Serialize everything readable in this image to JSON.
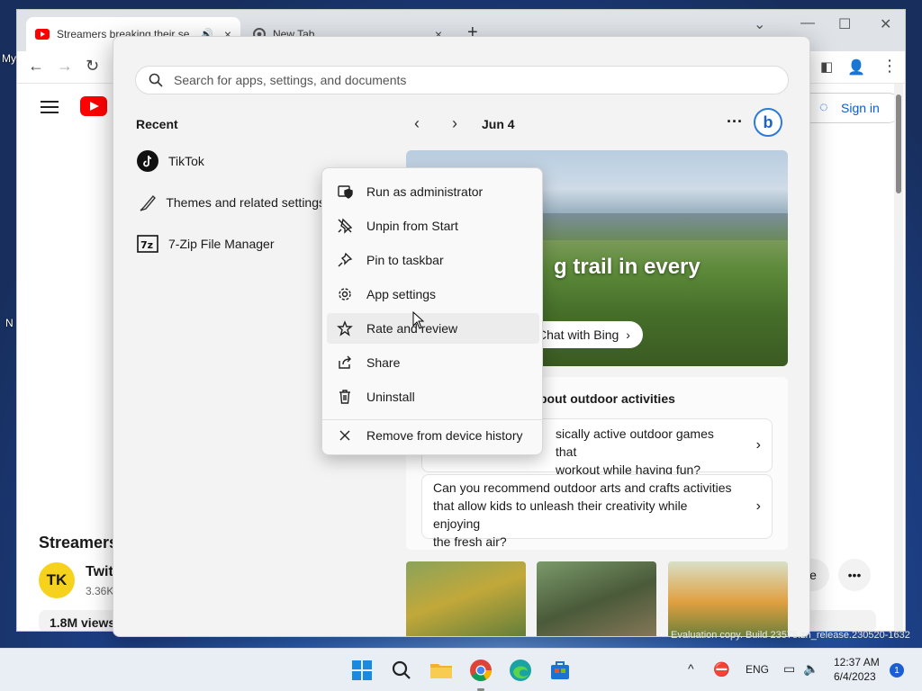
{
  "desktop": {
    "label_top": "My",
    "label_mid": "N"
  },
  "browser": {
    "tabs": [
      {
        "title": "Streamers breaking their se",
        "close": "×"
      },
      {
        "title": "New Tab",
        "close": "×"
      }
    ],
    "new_tab": "+",
    "window_controls": {
      "dropdown": "⌄",
      "minimize": "—",
      "maximize": "☐",
      "close": "✕"
    }
  },
  "youtube": {
    "sign_in": "Sign in",
    "video_title": "Streamers",
    "channel_avatar": "TK",
    "channel_name": "Twit",
    "subscribers": "3.36K",
    "views": "1.8M views",
    "right_btn": "e",
    "more": "•••"
  },
  "start_menu": {
    "search_placeholder": "Search for apps, settings, and documents",
    "recent_title": "Recent",
    "recent_items": [
      {
        "label": "TikTok",
        "icon": "tiktok-icon"
      },
      {
        "label": "Themes and related settings",
        "icon": "brush-icon"
      },
      {
        "label": "7-Zip File Manager",
        "icon": "7zip-icon"
      }
    ],
    "date": "Jun 4",
    "more": "···",
    "bing": "b",
    "hero_headline": "g trail in every",
    "chat_with_bing": "Chat with Bing",
    "chat_chevron": "›",
    "suggest_title": "bout outdoor activities",
    "suggestions": [
      {
        "text_1": "sically active outdoor games that",
        "text_2": "workout while having fun?"
      },
      {
        "text_1": "Can you recommend outdoor arts and crafts activities",
        "text_2": "that allow kids to unleash their creativity while enjoying",
        "text_3": "the fresh air?"
      }
    ],
    "chevron": "›"
  },
  "context_menu": {
    "items": [
      {
        "label": "Run as administrator",
        "icon": "shield-icon"
      },
      {
        "label": "Unpin from Start",
        "icon": "unpin-icon"
      },
      {
        "label": "Pin to taskbar",
        "icon": "pin-icon"
      },
      {
        "label": "App settings",
        "icon": "gear-icon"
      },
      {
        "label": "Rate and review",
        "icon": "star-icon"
      },
      {
        "label": "Share",
        "icon": "share-icon"
      },
      {
        "label": "Uninstall",
        "icon": "trash-icon"
      },
      {
        "label": "Remove from device history",
        "icon": "close-icon"
      }
    ]
  },
  "taskbar": {
    "eval": "Evaluation copy. Build 23575.zn_release.230520-1632",
    "lang": "ENG",
    "time": "12:37 AM",
    "date": "6/4/2023",
    "notifications": "1",
    "tray_chevron": "^"
  },
  "colors": {
    "accent": "#1a5fd0",
    "youtube_red": "#ff0000",
    "bing_blue": "#1e62c7"
  }
}
